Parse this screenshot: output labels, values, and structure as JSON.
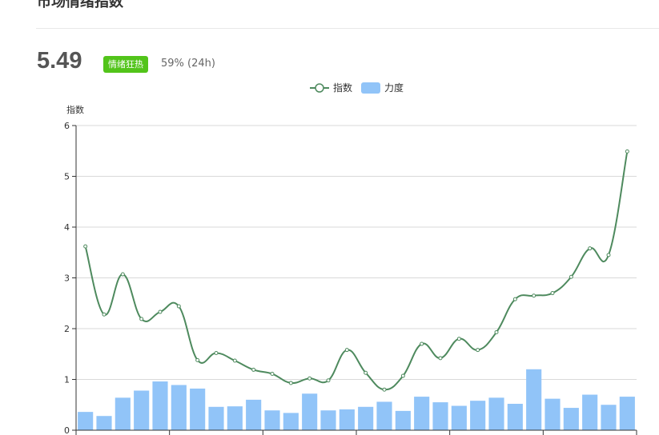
{
  "header": {
    "title": "市场情绪指数",
    "current_value": "5.49",
    "mood_badge": "情绪狂热",
    "change_text": "59% (24h)"
  },
  "colors": {
    "line": "#4e8a5e",
    "bar": "#91c4f8",
    "badge": "#52c41a"
  },
  "chart_data": {
    "type": "line",
    "title": "",
    "ylabel": "指数",
    "ylim": [
      0,
      6
    ],
    "yticks": [
      "0",
      "1",
      "2",
      "3",
      "4",
      "5",
      "6"
    ],
    "grid": true,
    "legend_position": "top-center",
    "series": [
      {
        "name": "指数",
        "type": "line",
        "values": [
          3.62,
          2.28,
          3.07,
          2.19,
          2.33,
          2.44,
          1.38,
          1.52,
          1.37,
          1.19,
          1.11,
          0.93,
          1.02,
          0.98,
          1.58,
          1.13,
          0.8,
          1.07,
          1.7,
          1.42,
          1.8,
          1.58,
          1.93,
          2.58,
          2.65,
          2.7,
          3.02,
          3.58,
          3.45,
          5.49
        ]
      },
      {
        "name": "力度",
        "type": "bar",
        "values": [
          0.36,
          0.28,
          0.64,
          0.78,
          0.96,
          0.89,
          0.82,
          0.46,
          0.47,
          0.6,
          0.39,
          0.34,
          0.72,
          0.39,
          0.41,
          0.46,
          0.56,
          0.38,
          0.66,
          0.55,
          0.48,
          0.58,
          0.64,
          0.52,
          1.2,
          0.62,
          0.44,
          0.7,
          0.5,
          0.66
        ]
      }
    ]
  }
}
